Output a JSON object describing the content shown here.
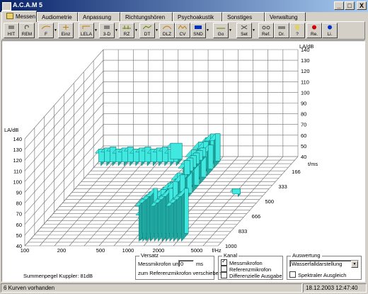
{
  "window": {
    "title": "A.C.A.M 5",
    "minimize": "_",
    "maximize": "□",
    "close": "X"
  },
  "tabs": [
    "Messen",
    "Audiometrie",
    "Anpassung",
    "Richtungshören",
    "Psychoakustik",
    "Sonstiges",
    "Verwaltung"
  ],
  "toolbar": {
    "hit": "HIT",
    "rem": "REM",
    "f": "F",
    "einz": "Einz",
    "lela": "LELA",
    "threed": "3-D",
    "rz": "RZ",
    "dt": "DT",
    "dlz": "DLZ",
    "cv": "CV",
    "snd": "SND",
    "go": "Go",
    "set": "Set",
    "ref": "Ref.",
    "dr": "Dr.",
    "help": "?",
    "re": "Re.",
    "li": "Li."
  },
  "chart_data": {
    "type": "3d-bar",
    "x_axis": {
      "label": "f/Hz",
      "scale": "log",
      "ticks": [
        "100",
        "200",
        "500",
        "1000",
        "2000",
        "5000",
        "f/Hz"
      ]
    },
    "y_axis": {
      "label": "t/ms",
      "ticks": [
        "166",
        "333",
        "500",
        "666",
        "833",
        "1000"
      ]
    },
    "z_axis": {
      "label": "LA/dB",
      "ticks": [
        "40",
        "50",
        "60",
        "70",
        "80",
        "90",
        "100",
        "110",
        "120",
        "130",
        "140"
      ]
    },
    "back_z_label": "LA/dB",
    "back_z_ticks": [
      "140",
      "130",
      "120",
      "110",
      "100",
      "90",
      "80",
      "70",
      "60",
      "50",
      "40"
    ],
    "bar_color": "#40e8e0"
  },
  "footer": {
    "sum_level": "Summenpegel Kuppler: 81dB",
    "versatz": {
      "title": "Versatz",
      "prefix": "Messmikrofon um:",
      "value": "0",
      "unit": "ms",
      "suffix": "zum Referenzmikrofon verschieben."
    },
    "kanal": {
      "title": "Kanal",
      "options": [
        {
          "label": "Messmikrofon",
          "checked": true
        },
        {
          "label": "Referenzmikrofon",
          "checked": false
        },
        {
          "label": "Differenzielle Ausgabe",
          "checked": false
        }
      ]
    },
    "auswertung": {
      "title": "Auswertung",
      "selected": "Wasserfalldarstellung",
      "spectral": "Spektraler Ausgleich",
      "spectral_checked": false
    }
  },
  "status": {
    "left": "6 Kurven vorhanden",
    "right": "18.12.2003 12:47:40"
  }
}
